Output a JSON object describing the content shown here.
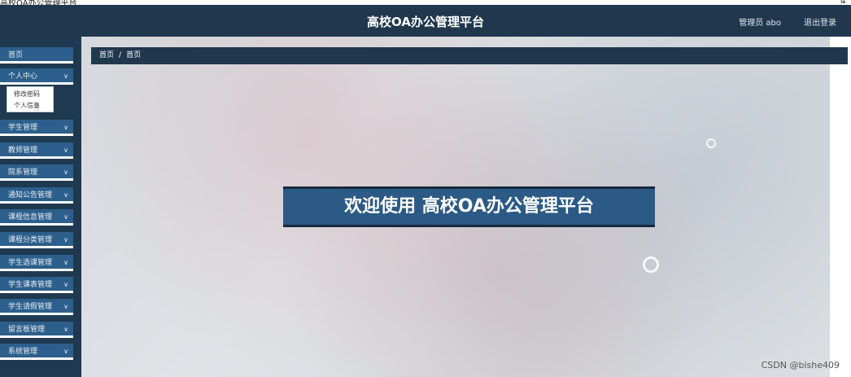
{
  "window": {
    "title": "高校OA办公管理平台",
    "corner_icon": "resize-arrows-icon"
  },
  "header": {
    "brand": "高校OA办公管理平台",
    "user": "管理员 abo",
    "logout": "退出登录"
  },
  "sidebar": {
    "items": [
      {
        "label": "首页",
        "chevron": false
      },
      {
        "label": "个人中心",
        "chevron": true
      },
      {
        "label": "学生管理",
        "chevron": true
      },
      {
        "label": "教师管理",
        "chevron": true
      },
      {
        "label": "院系管理",
        "chevron": true
      },
      {
        "label": "通知公告管理",
        "chevron": true
      },
      {
        "label": "课程信息管理",
        "chevron": true
      },
      {
        "label": "课程分类管理",
        "chevron": true
      },
      {
        "label": "学生选课管理",
        "chevron": true
      },
      {
        "label": "学生课表管理",
        "chevron": true
      },
      {
        "label": "学生请假管理",
        "chevron": true
      },
      {
        "label": "留言板管理",
        "chevron": true
      },
      {
        "label": "系统管理",
        "chevron": true
      }
    ],
    "submenu": [
      {
        "label": "修改密码"
      },
      {
        "label": "个人信息"
      }
    ]
  },
  "breadcrumb": {
    "home": "首页",
    "separator": "/",
    "current": "首页"
  },
  "main": {
    "welcome": "欢迎使用 高校OA办公管理平台"
  },
  "watermark": "CSDN @bishe409",
  "colors": {
    "header": "#21374e",
    "sidebar": "#1f3950",
    "menu_item": "#2c5f8c",
    "welcome_bg": "#2c5a86"
  }
}
